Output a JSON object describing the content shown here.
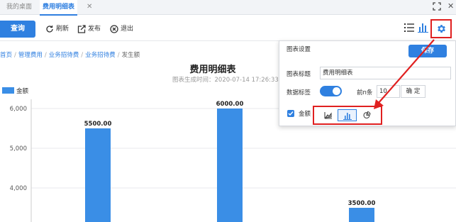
{
  "tabs": {
    "home_label": "我的桌面",
    "active_label": "费用明细表",
    "close_symbol": "✕",
    "window_close_symbol": "✕"
  },
  "toolbar": {
    "query_label": "查询",
    "refresh_label": "刷新",
    "publish_label": "发布",
    "exit_label": "退出",
    "list_icon": "list-icon",
    "chart_icon": "bar-chart-icon",
    "settings_icon": "gear-icon"
  },
  "breadcrumb": {
    "items": [
      "首页",
      "管理费用",
      "业务招待费",
      "业务招待费"
    ],
    "current": "发生额",
    "separator": "/"
  },
  "chart_header": {
    "title": "费用明细表",
    "generated_time": "图表生成时间：2020-07-14 17:26:33"
  },
  "chart_data": {
    "type": "bar",
    "title": "费用明细表",
    "series": [
      {
        "name": "金额",
        "values": [
          5500,
          6000,
          3500
        ]
      }
    ],
    "data_labels": [
      "5500.00",
      "6000.00",
      "3500.00"
    ],
    "y_ticks": [
      "6,000",
      "5,000",
      "4,000"
    ],
    "y_tick_values": [
      6000,
      5000,
      4000
    ],
    "ylim": [
      3500,
      6000
    ],
    "grid": true,
    "legend_position": "top-left",
    "bar_color": "#3a8ee6",
    "category_labels_visible": false
  },
  "settings_popup": {
    "title": "图表设置",
    "save_label": "保存",
    "chart_title_label": "图表标题",
    "chart_title_value": "费用明细表",
    "data_labels_label": "数据标签",
    "data_labels_on": true,
    "top_n_label": "前n条",
    "top_n_value": "10",
    "confirm_label": "确 定",
    "series_label": "金额",
    "series_checked": true,
    "chart_types": [
      "area-chart-icon",
      "bar-chart-icon",
      "pie-chart-icon"
    ],
    "selected_chart_type": "bar-chart-icon"
  },
  "colors": {
    "primary": "#2f80e0",
    "highlight_annotation": "#e02020"
  }
}
